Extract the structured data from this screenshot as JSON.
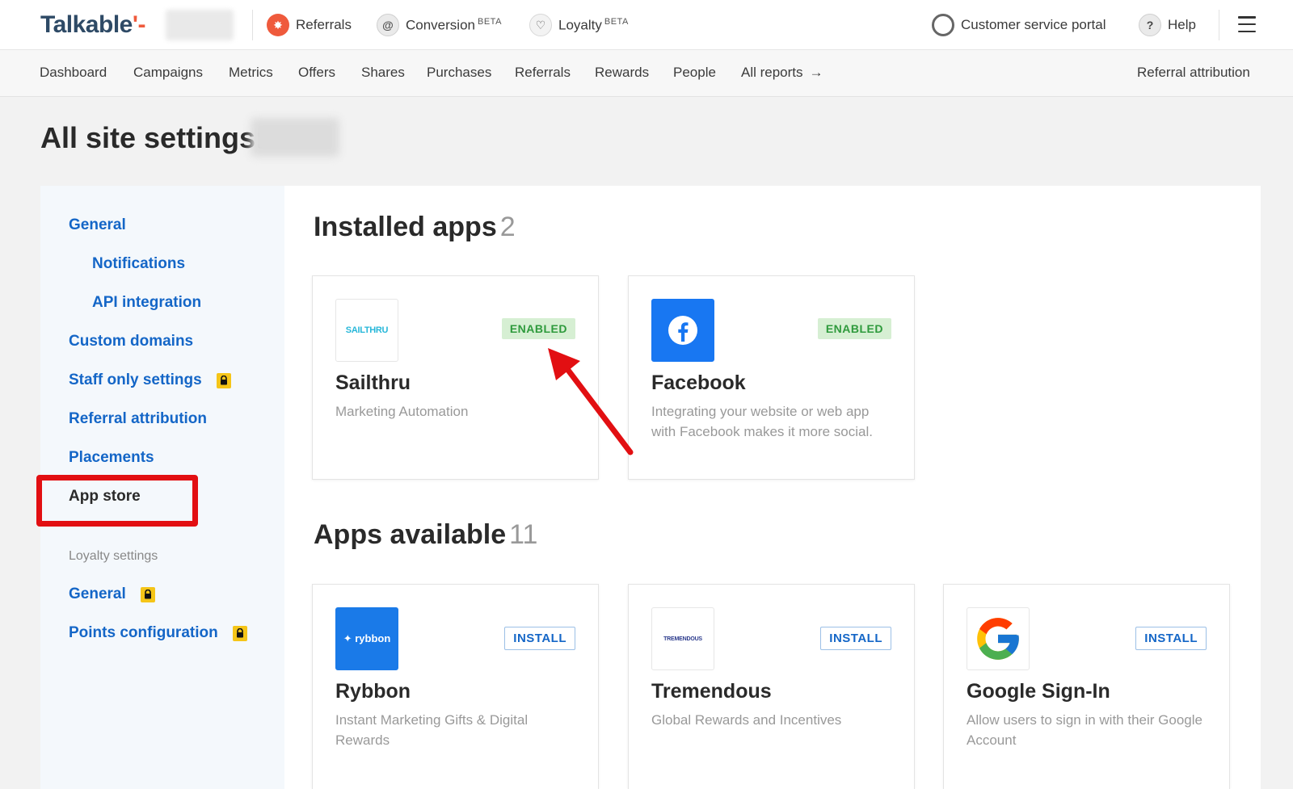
{
  "topbar": {
    "logo_text": "Talkable",
    "products": [
      {
        "label": "Referrals",
        "icon": "referrals-icon"
      },
      {
        "label": "Conversion",
        "badge": "BETA",
        "icon": "at-sign-icon"
      },
      {
        "label": "Loyalty",
        "badge": "BETA",
        "icon": "heart-icon"
      }
    ],
    "portal_label": "Customer service portal",
    "help_label": "Help"
  },
  "subnav": {
    "items": [
      "Dashboard",
      "Campaigns",
      "Metrics",
      "Offers",
      "Shares",
      "Purchases",
      "Referrals",
      "Rewards",
      "People",
      "All reports"
    ],
    "right_link": "Referral attribution"
  },
  "page": {
    "title": "All site settings:"
  },
  "sidebar": {
    "general": "General",
    "notifications": "Notifications",
    "api_integration": "API integration",
    "custom_domains": "Custom domains",
    "staff_only": "Staff only settings",
    "referral_attribution": "Referral attribution",
    "placements": "Placements",
    "app_store": "App store",
    "loyalty_heading": "Loyalty settings",
    "loyalty_general": "General",
    "points_configuration": "Points configuration"
  },
  "installed": {
    "title": "Installed apps",
    "count": "2",
    "apps": [
      {
        "name": "Sailthru",
        "logo_text": "SAILTHRU",
        "status": "ENABLED",
        "description": "Marketing Automation"
      },
      {
        "name": "Facebook",
        "status": "ENABLED",
        "description": "Integrating your website or web app with Facebook makes it more social."
      }
    ]
  },
  "available": {
    "title": "Apps available",
    "count": "11",
    "apps": [
      {
        "name": "Rybbon",
        "logo_text": "rybbon",
        "action": "INSTALL",
        "description": "Instant Marketing Gifts & Digital Rewards"
      },
      {
        "name": "Tremendous",
        "logo_text": "TREMENDOUS",
        "action": "INSTALL",
        "description": "Global Rewards and Incentives"
      },
      {
        "name": "Google Sign-In",
        "action": "INSTALL",
        "description": "Allow users to sign in with their Google Account"
      }
    ]
  },
  "colors": {
    "link_blue": "#1466c7",
    "brand_orange": "#ef5a3c",
    "highlight_red": "#e20f12",
    "enabled_green": "#2e9a3c"
  }
}
